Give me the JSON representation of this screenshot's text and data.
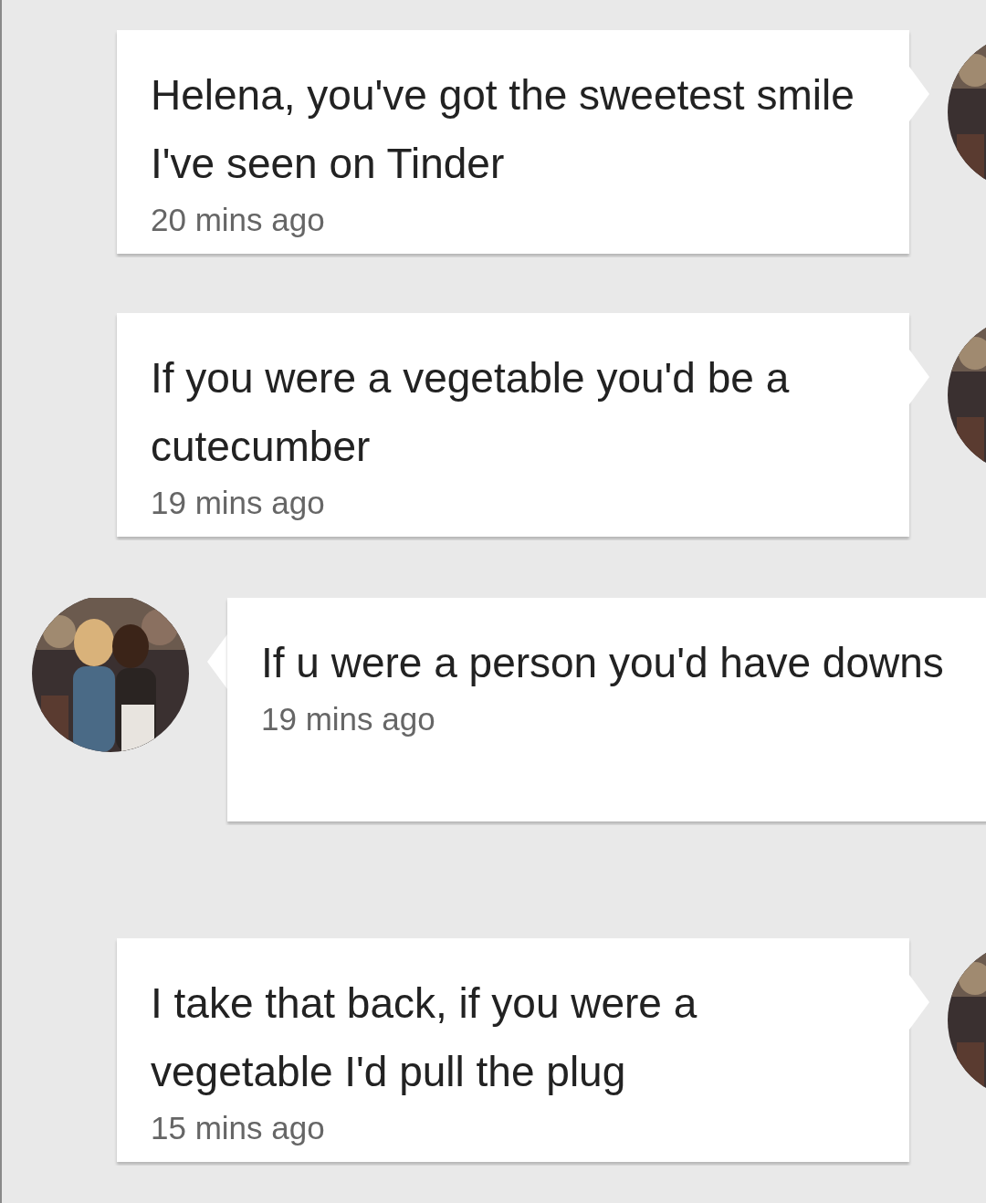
{
  "messages": [
    {
      "kind": "outgoing",
      "text": "Helena, you've got the sweetest smile I've seen on Tinder",
      "time": "20 mins ago"
    },
    {
      "kind": "outgoing",
      "text": "If you were a vegetable you'd be a cutecumber",
      "time": "19 mins ago"
    },
    {
      "kind": "incoming",
      "text": "If u were a person you'd have downs",
      "time": "19 mins ago"
    },
    {
      "kind": "outgoing",
      "text": "I take that back, if you were a vegetable I'd pull the plug",
      "time": "15 mins ago"
    }
  ]
}
